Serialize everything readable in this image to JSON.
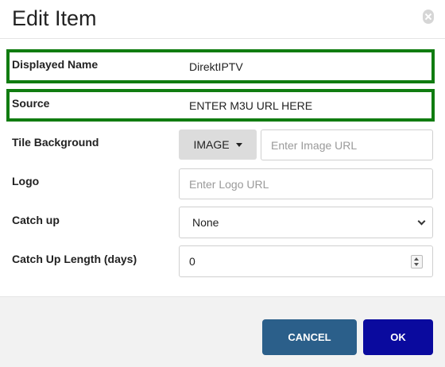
{
  "dialog": {
    "title": "Edit Item",
    "close_icon": "close-x-icon"
  },
  "form": {
    "displayed_name": {
      "label": "Displayed Name",
      "value": "DirektIPTV"
    },
    "source": {
      "label": "Source",
      "value": "ENTER M3U URL HERE"
    },
    "tile_background": {
      "label": "Tile Background",
      "button_label": "IMAGE",
      "placeholder": "Enter Image URL"
    },
    "logo": {
      "label": "Logo",
      "placeholder": "Enter Logo URL"
    },
    "catch_up": {
      "label": "Catch up",
      "selected": "None"
    },
    "catch_up_length": {
      "label": "Catch Up Length (days)",
      "value": "0"
    }
  },
  "footer": {
    "cancel_label": "CANCEL",
    "ok_label": "OK"
  },
  "colors": {
    "highlight": "#107c10",
    "cancel_bg": "#2b5f8a",
    "ok_bg": "#0a0a9e",
    "footer_bg": "#f2f2f2"
  }
}
